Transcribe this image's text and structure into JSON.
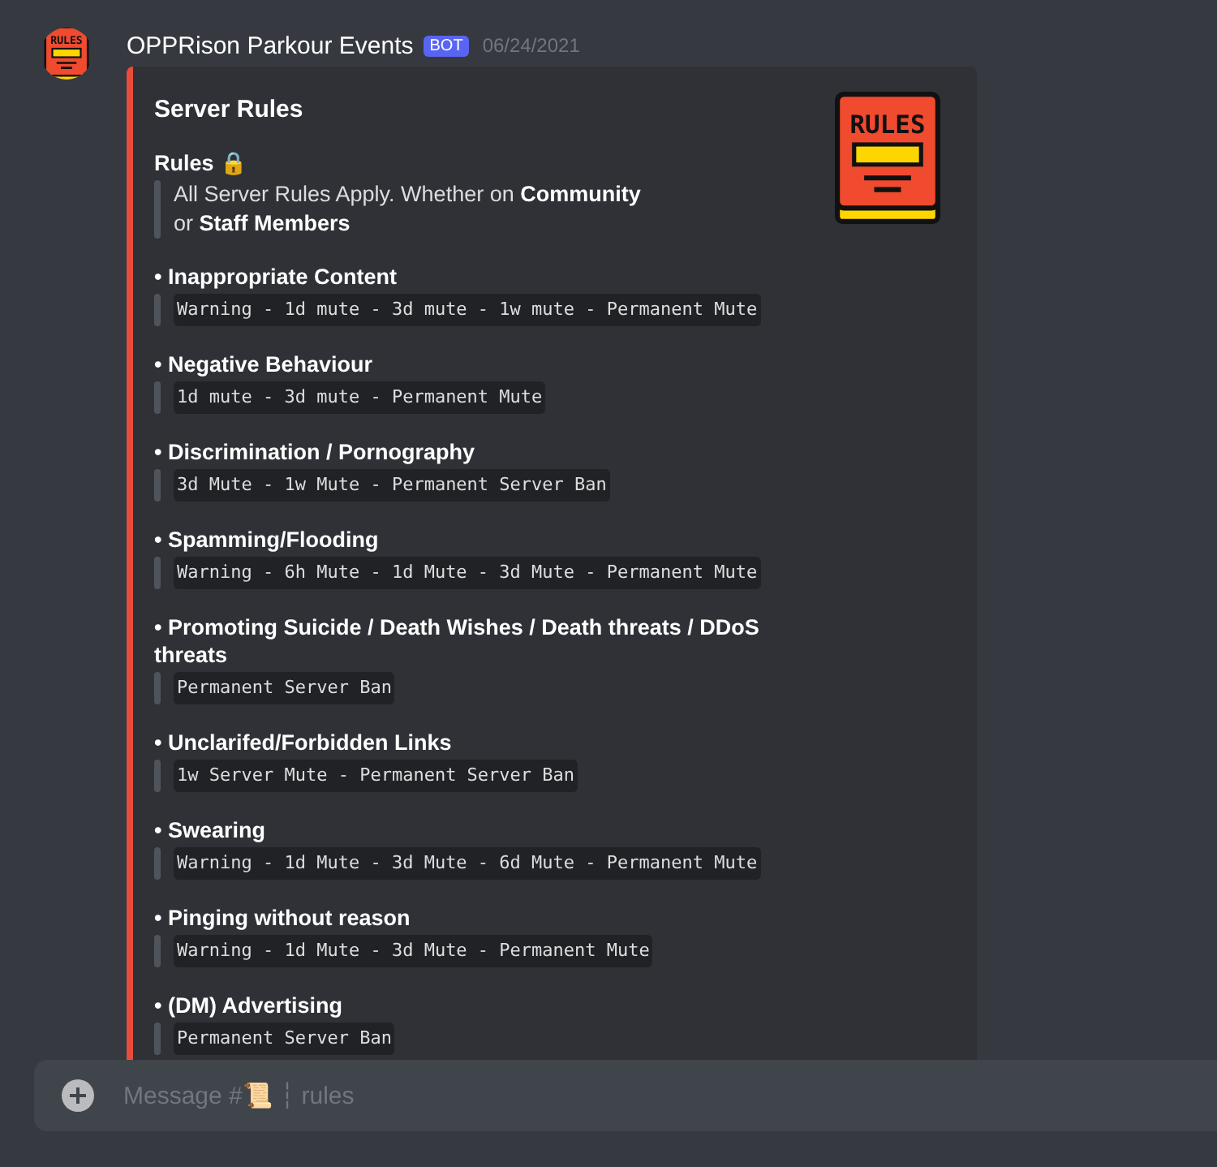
{
  "message": {
    "author": "OPPRison Parkour Events",
    "badge": "BOT",
    "timestamp": "06/24/2021",
    "avatar": {
      "label": "RULES"
    },
    "embed": {
      "title": "Server Rules",
      "thumbnail": {
        "label": "RULES"
      },
      "color": "#e74c3c",
      "fields": [
        {
          "name": "Rules 🔒",
          "kind": "text",
          "value": "All Server Rules Apply. Whether on **Community**\nor **Staff Members**"
        },
        {
          "name": "• Inappropriate Content",
          "kind": "code",
          "value": "Warning - 1d mute - 3d mute - 1w mute - Permanent Mute"
        },
        {
          "name": "• Negative Behaviour",
          "kind": "code",
          "value": "1d mute - 3d mute - Permanent Mute"
        },
        {
          "name": "• Discrimination / Pornography",
          "kind": "code",
          "value": "3d Mute - 1w Mute - Permanent Server Ban"
        },
        {
          "name": "• Spamming/Flooding",
          "kind": "code",
          "value": "Warning - 6h Mute - 1d Mute - 3d Mute - Permanent Mute"
        },
        {
          "name": "• Promoting Suicide / Death Wishes / Death threats / DDoS threats",
          "kind": "code",
          "value": "Permanent Server Ban"
        },
        {
          "name": "• Unclarifed/Forbidden Links",
          "kind": "code",
          "value": "1w Server Mute - Permanent Server Ban"
        },
        {
          "name": "• Swearing",
          "kind": "code",
          "value": "Warning - 1d Mute - 3d Mute - 6d Mute - Permanent Mute"
        },
        {
          "name": "• Pinging without reason",
          "kind": "code",
          "value": "Warning - 1d Mute - 3d Mute - Permanent Mute"
        },
        {
          "name": "• (DM) Advertising",
          "kind": "code",
          "value": "Permanent Server Ban"
        }
      ]
    }
  },
  "composer": {
    "placeholder": "Message #📜 ┆ rules"
  }
}
